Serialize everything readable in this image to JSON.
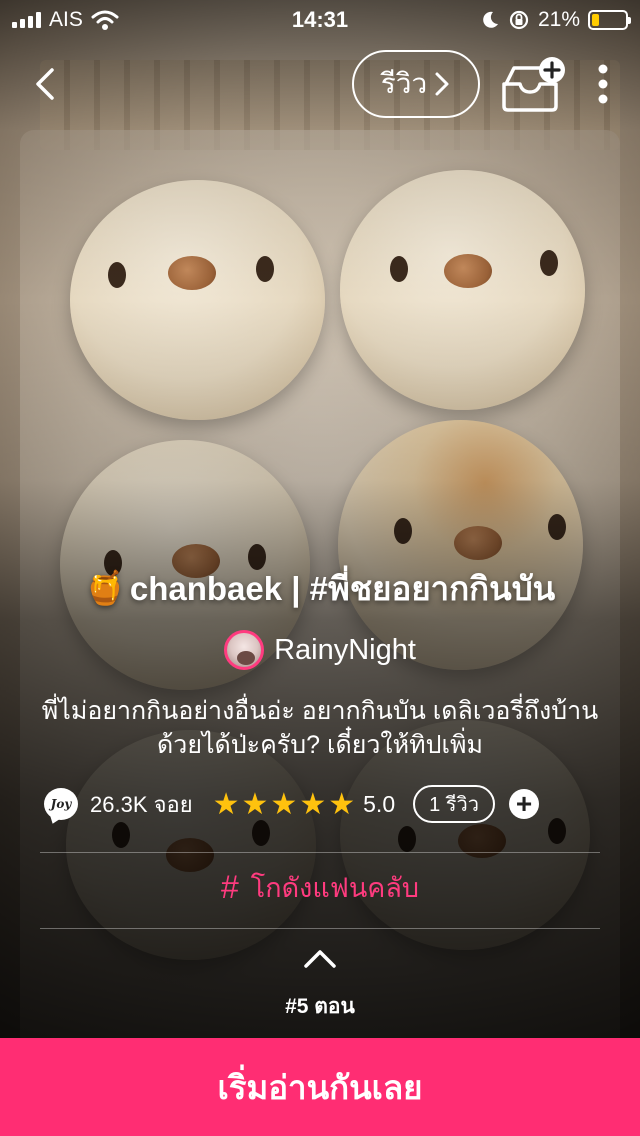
{
  "status_bar": {
    "carrier": "AIS",
    "time": "14:31",
    "battery_percent": "21%",
    "battery_level": 0.21,
    "icons": [
      "signal-icon",
      "wifi-icon",
      "moon-icon",
      "rotation-lock-icon",
      "battery-icon"
    ]
  },
  "nav": {
    "review_label": "รีวิว",
    "icons": [
      "back-arrow-icon",
      "chevron-right-icon",
      "add-to-shelf-icon",
      "more-vertical-icon"
    ]
  },
  "story": {
    "title_emoji": "🍯",
    "title": "chanbaek | #พี่ชยอยากกินบัน",
    "author": "RainyNight",
    "synopsis": "พี่ไม่อยากกินอย่างอื่นอ่ะ อยากกินบัน เดลิเวอรี่ถึงบ้านด้วยได้ป่ะครับ? เดี๋ยวให้ทิปเพิ่ม",
    "joy_icon_label": "Joy",
    "joy_count": "26.3K จอย",
    "stars_filled": 5,
    "stars_total": 5,
    "rating": "5.0",
    "review_count": "1 รีวิว",
    "tag": "โกดังแฟนคลับ",
    "episode": "#5 ตอน"
  },
  "actions": {
    "start_reading": "เริ่มอ่านกันเลย"
  },
  "colors": {
    "accent": "#ff2d73",
    "tag": "#ff3b7f",
    "star": "#ffc20e",
    "battery": "#ffcc00"
  }
}
